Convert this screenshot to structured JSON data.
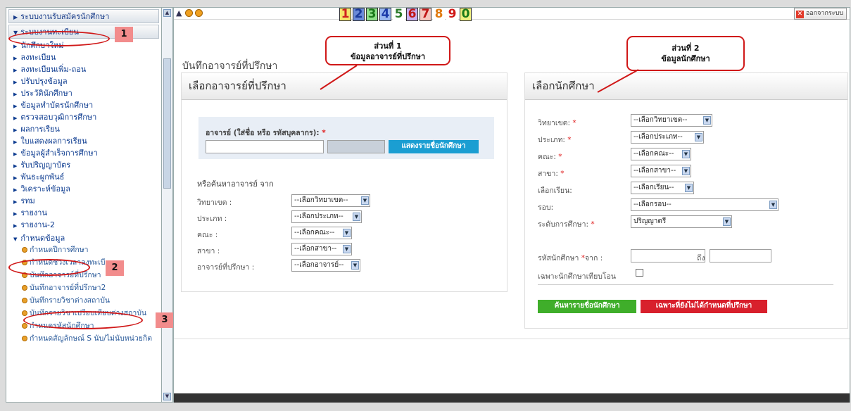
{
  "sidebar": {
    "head1": "ระบบงานรับสมัครนักศึกษา",
    "head2": "ระบบงานทะเบียน",
    "items": [
      "นักศึกษาใหม่",
      "ลงทะเบียน",
      "ลงทะเบียนเพิ่ม-ถอน",
      "ปรับปรุงข้อมูล",
      "ประวัตินักศึกษา",
      "ข้อมูลทำบัตรนักศึกษา",
      "ตรวจสอบวุฒิการศึกษา",
      "ผลการเรียน",
      "ใบแสดงผลการเรียน",
      "ข้อมูลผู้สำเร็จการศึกษา",
      "รับปริญญาบัตร",
      "พันธะผูกพันธ์",
      "วิเคราะห์ข้อมูล",
      "รทม",
      "รายงาน",
      "รายงาน-2"
    ],
    "section": "กำหนดข้อมูล",
    "subitems": [
      "กำหนดปีการศึกษา",
      "กำหนดช่วงเวลาลงทะเบียน",
      "บันทึกอาจารย์ที่ปรึกษา",
      "บันทึกอาจารย์ที่ปรึกษา2",
      "บันทึกรายวิชาต่างสถาบัน",
      "บันทึกรายวิชาเปรียบเทียบต่างสถาบัน",
      "กำหนดรหัสนักศึกษา",
      "กำหนดสัญลักษณ์ S นับ/ไม่นับหน่วยกิต"
    ]
  },
  "topbar": {
    "numbers": [
      "1",
      "2",
      "3",
      "4",
      "5",
      "6",
      "7",
      "8",
      "9",
      "0"
    ],
    "logout": "ออกจากระบบ"
  },
  "page_title": "บันทึกอาจารย์ที่ปรึกษา",
  "callout1": {
    "line1": "ส่วนที่ 1",
    "line2": "ข้อมูลอาจารย์ที่ปรึกษา"
  },
  "callout2": {
    "line1": "ส่วนที่ 2",
    "line2": "ข้อมูลนักศึกษา"
  },
  "badges": [
    "1",
    "2",
    "3"
  ],
  "left_panel": {
    "title": "เลือกอาจารย์ที่ปรึกษา",
    "teacher_label": "อาจารย์ (ใส่ชื่อ หรือ รหัสบุคลากร):",
    "show_button": "แสดงรายชื่อนักศึกษา",
    "search_heading": "หรือค้นหาอาจารย์ จาก",
    "fields": [
      {
        "label": "วิทยาเขต :",
        "value": "--เลือกวิทยาเขต--"
      },
      {
        "label": "ประเภท :",
        "value": "--เลือกประเภท--"
      },
      {
        "label": "คณะ :",
        "value": "--เลือกคณะ--"
      },
      {
        "label": "สาขา :",
        "value": "--เลือกสาขา--"
      },
      {
        "label": "อาจารย์ที่ปรึกษา :",
        "value": "--เลือกอาจารย์--"
      }
    ]
  },
  "right_panel": {
    "title": "เลือกนักศึกษา",
    "fields": [
      {
        "label": "วิทยาเขต:",
        "value": "--เลือกวิทยาเขต--"
      },
      {
        "label": "ประเภท:",
        "value": "--เลือกประเภท--"
      },
      {
        "label": "คณะ:",
        "value": "--เลือกคณะ--"
      },
      {
        "label": "สาขา:",
        "value": "--เลือกสาขา--"
      },
      {
        "label": "เลือกเรียน:",
        "value": "--เลือกเรียน--"
      },
      {
        "label": "รอบ:",
        "value": "--เลือกรอบ--"
      },
      {
        "label": "ระดับการศึกษา:",
        "value": "ปริญญาตรี"
      }
    ],
    "student_id_label": "รหัสนักศึกษา",
    "from_label": "จาก :",
    "to_label": "ถึง",
    "transfer_label": "เฉพาะนักศึกษาเทียบโอน",
    "search_button": "ค้นหารายชื่อนักศึกษา",
    "unassigned_button": "เฉพาะที่ยังไม่ได้กำหนดที่ปรึกษา"
  },
  "colors": {
    "link": "#0b3a8f",
    "accent_blue": "#1b9ed2",
    "green": "#3fae2a",
    "red": "#d8202c",
    "callout_red": "#d01818"
  }
}
